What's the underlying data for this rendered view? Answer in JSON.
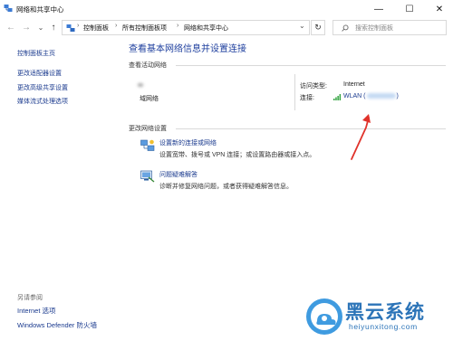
{
  "window": {
    "title": "网络和共享中心",
    "minimize_symbol": "—",
    "maximize_symbol": "☐",
    "close_symbol": "✕"
  },
  "nav": {
    "back_symbol": "←",
    "forward_symbol": "→",
    "recent_symbol": "⌄",
    "up_symbol": "↑",
    "breadcrumb": [
      "控制面板",
      "所有控制面板项",
      "网络和共享中心"
    ],
    "separator": "›",
    "dropdown_symbol": "⌄",
    "refresh_symbol": "↻",
    "search_placeholder": "搜索控制面板"
  },
  "sidebar": {
    "items": [
      "控制面板主页",
      "更改适配器设置",
      "更改高级共享设置",
      "媒体流式处理选项"
    ],
    "see_also_label": "另请参阅",
    "bottom_links": [
      "Internet 选项",
      "Windows Defender 防火墙"
    ]
  },
  "main": {
    "heading": "查看基本网络信息并设置连接",
    "active_networks_label": "查看活动网络",
    "network_type": "域网络",
    "access_type_label": "访问类型:",
    "access_type_value": "Internet",
    "connections_label": "连接:",
    "connection_name": "WLAN (",
    "connection_suffix": ")",
    "change_settings_label": "更改网络设置",
    "tasks": [
      {
        "title": "设置新的连接或网络",
        "desc": "设置宽带、拨号或 VPN 连接；或设置路由器或接入点。"
      },
      {
        "title": "问题疑难解答",
        "desc": "诊断并修复网络问题，或者获得疑难解答信息。"
      }
    ]
  },
  "watermark": {
    "title": "黑云系统",
    "url": "heiyunxitong.com"
  },
  "colors": {
    "link": "#1a3a8e",
    "heading": "#1e3f9e",
    "annotation_arrow": "#e0322a",
    "watermark": "#2c74b8"
  }
}
